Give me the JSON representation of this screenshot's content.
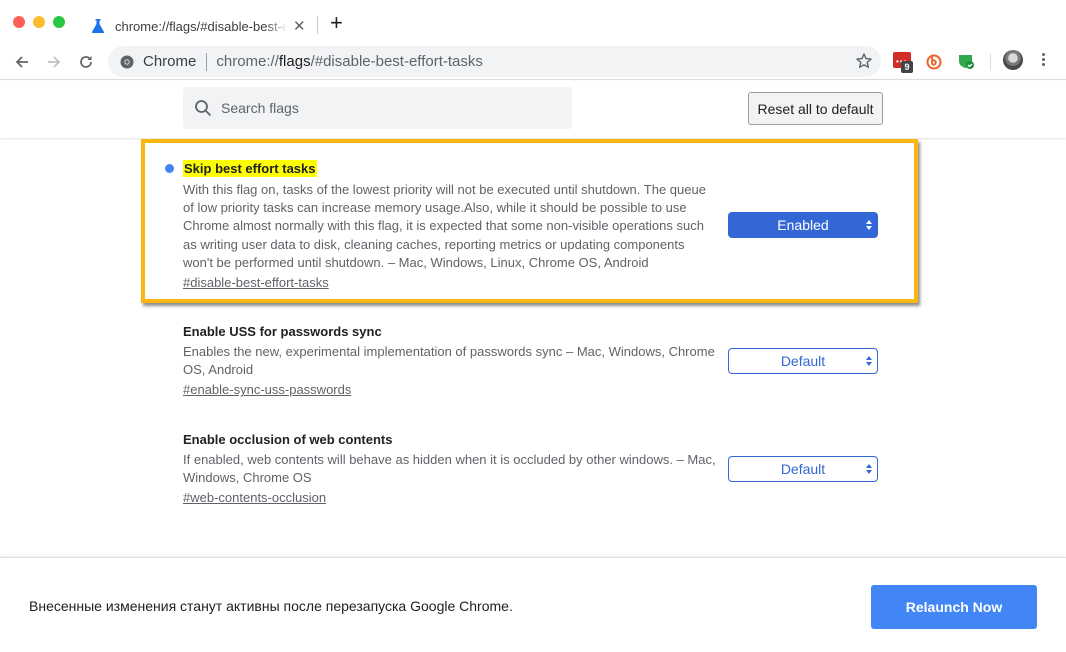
{
  "window": {
    "tab": {
      "title": "chrome://flags/#disable-best-effort-tasks",
      "icon": "flask-icon",
      "close_glyph": "✕"
    },
    "new_tab_glyph": "+"
  },
  "toolbar": {
    "omnibox": {
      "site_label": "Chrome",
      "url_prefix": "chrome://",
      "url_host": "flags",
      "url_rest": "/#disable-best-effort-tasks"
    },
    "extensions": [
      {
        "name": "lastpass-extension",
        "badge": "9",
        "color": "#d32d27"
      },
      {
        "name": "bitly-extension",
        "color": "#ee6123"
      },
      {
        "name": "shield-extension",
        "color": "#2fa84f"
      }
    ]
  },
  "header": {
    "search_placeholder": "Search flags",
    "search_value": "",
    "reset_label": "Reset all to default"
  },
  "flags": [
    {
      "title": "Skip best effort tasks",
      "modified": true,
      "highlighted": true,
      "description": "With this flag on, tasks of the lowest priority will not be executed until shutdown. The queue of low priority tasks can increase memory usage.Also, while it should be possible to use Chrome almost normally with this flag, it is expected that some non-visible operations such as writing user data to disk, cleaning caches, reporting metrics or updating components won't be performed until shutdown. – Mac, Windows, Linux, Chrome OS, Android",
      "link": "#disable-best-effort-tasks",
      "value": "Enabled"
    },
    {
      "title": "Enable USS for passwords sync",
      "modified": false,
      "description": "Enables the new, experimental implementation of passwords sync – Mac, Windows, Chrome OS, Android",
      "link": "#enable-sync-uss-passwords",
      "value": "Default"
    },
    {
      "title": "Enable occlusion of web contents",
      "modified": false,
      "description": "If enabled, web contents will behave as hidden when it is occluded by other windows. – Mac, Windows, Chrome OS",
      "link": "#web-contents-occlusion",
      "value": "Default"
    }
  ],
  "relaunch": {
    "message": "Внесенные изменения станут активны после перезапуска Google Chrome.",
    "button_label": "Relaunch Now"
  },
  "colors": {
    "accent": "#3367d6",
    "relaunch_button": "#4285f4",
    "highlight_border": "#f9b70f",
    "title_highlight": "#ffff00"
  }
}
